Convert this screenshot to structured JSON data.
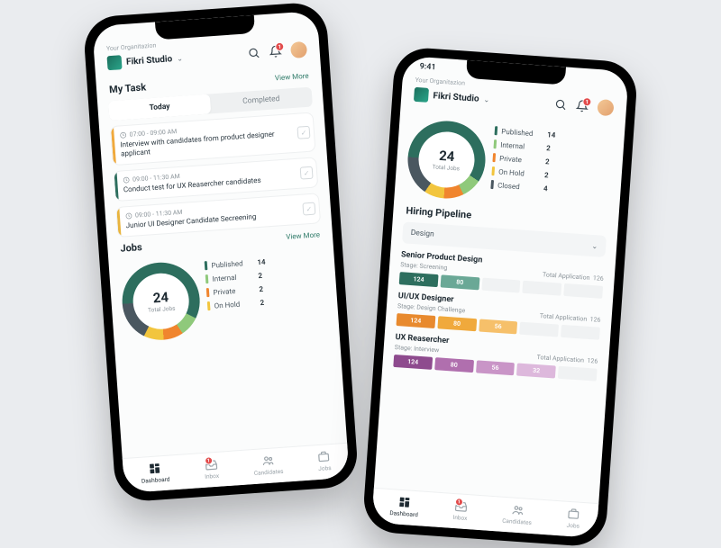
{
  "org_label": "Your Organitazion",
  "org_name": "Fikri Studio",
  "status_time": "9:41",
  "notif_count": "1",
  "my_task": {
    "title": "My Task",
    "view_more": "View More",
    "tab_today": "Today",
    "tab_completed": "Completed",
    "items": [
      {
        "color": "#f0a93c",
        "time": "07:00 - 09:00 AM",
        "title": "Interview with candidates from product designer applicant"
      },
      {
        "color": "#2d6e5e",
        "time": "09:00 - 11:30 AM",
        "title": "Conduct test for UX Reasercher candidates"
      },
      {
        "color": "#e8b43e",
        "time": "09:00 - 11:30 AM",
        "title": "Junior UI Designer Candidate Secreening"
      }
    ]
  },
  "jobs": {
    "title": "Jobs",
    "view_more": "View More",
    "total": "24",
    "total_label": "Total Jobs",
    "legend": [
      {
        "label": "Published",
        "count": "14",
        "color": "#2d6e5e"
      },
      {
        "label": "Internal",
        "count": "2",
        "color": "#8fc97b"
      },
      {
        "label": "Private",
        "count": "2",
        "color": "#f0852e"
      },
      {
        "label": "On Hold",
        "count": "2",
        "color": "#f2c53d"
      },
      {
        "label": "Closed",
        "count": "4",
        "color": "#4a5760"
      }
    ]
  },
  "pipeline": {
    "title": "Hiring Pipeline",
    "filter": "Design",
    "total_app_label": "Total Application",
    "jobs": [
      {
        "title": "Senior Product Design",
        "stage": "Stage: Screening",
        "total": "126",
        "segs": [
          {
            "v": "124",
            "c": "#2d6e5e"
          },
          {
            "v": "80",
            "c": "#6aa896"
          }
        ],
        "empties": 3
      },
      {
        "title": "UI/UX Designer",
        "stage": "Stage: Design Challenge",
        "total": "126",
        "segs": [
          {
            "v": "124",
            "c": "#e88a2e"
          },
          {
            "v": "80",
            "c": "#f0a93c"
          },
          {
            "v": "56",
            "c": "#f6c06a"
          }
        ],
        "empties": 2
      },
      {
        "title": "UX Reasercher",
        "stage": "Stage: Interview",
        "total": "126",
        "segs": [
          {
            "v": "124",
            "c": "#8e4b8e"
          },
          {
            "v": "80",
            "c": "#b06fae"
          },
          {
            "v": "56",
            "c": "#c995c7"
          },
          {
            "v": "32",
            "c": "#ddb8dc"
          }
        ],
        "empties": 1
      }
    ]
  },
  "nav": {
    "dashboard": "Dashboard",
    "inbox": "Inbox",
    "inbox_badge": "1",
    "candidates": "Candidates",
    "jobs": "Jobs"
  },
  "chart_data": {
    "type": "pie",
    "title": "Total Jobs",
    "total": 24,
    "series": [
      {
        "name": "Published",
        "value": 14,
        "color": "#2d6e5e"
      },
      {
        "name": "Internal",
        "value": 2,
        "color": "#8fc97b"
      },
      {
        "name": "Private",
        "value": 2,
        "color": "#f0852e"
      },
      {
        "name": "On Hold",
        "value": 2,
        "color": "#f2c53d"
      },
      {
        "name": "Closed",
        "value": 4,
        "color": "#4a5760"
      }
    ]
  }
}
